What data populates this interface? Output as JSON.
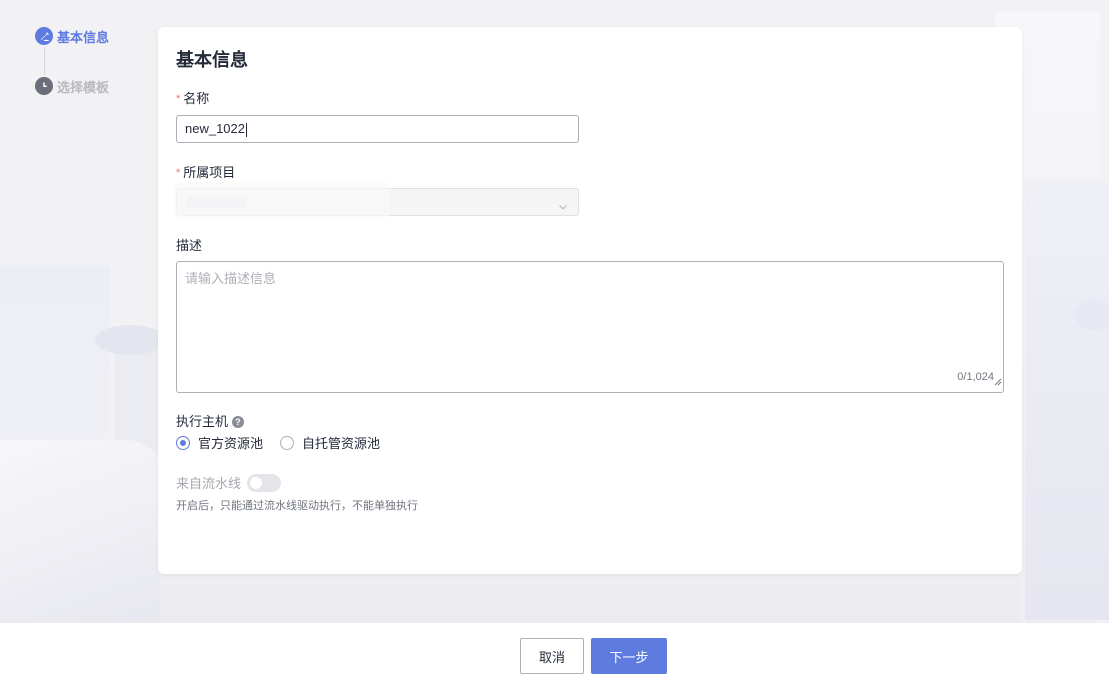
{
  "steps": [
    {
      "label": "基本信息",
      "state": "active",
      "icon": "edit-icon"
    },
    {
      "label": "选择模板",
      "state": "inactive",
      "icon": "clock-icon"
    }
  ],
  "form": {
    "title": "基本信息",
    "name": {
      "label": "名称",
      "value": "new_1022",
      "required": true
    },
    "project": {
      "label": "所属项目",
      "value": "",
      "required": true
    },
    "description": {
      "label": "描述",
      "placeholder": "请输入描述信息",
      "counter": "0/1,024"
    },
    "host": {
      "label": "执行主机",
      "help_icon": "?",
      "options": [
        {
          "label": "官方资源池",
          "checked": true
        },
        {
          "label": "自托管资源池",
          "checked": false
        }
      ]
    },
    "pipeline": {
      "label": "来自流水线",
      "enabled": false,
      "help": "开启后，只能通过流水线驱动执行，不能单独执行"
    }
  },
  "footer": {
    "cancel_label": "取消",
    "next_label": "下一步"
  },
  "colors": {
    "primary": "#5e7ce0",
    "required": "#f66f6a",
    "text": "#252b3a",
    "muted": "#adb0b8"
  }
}
